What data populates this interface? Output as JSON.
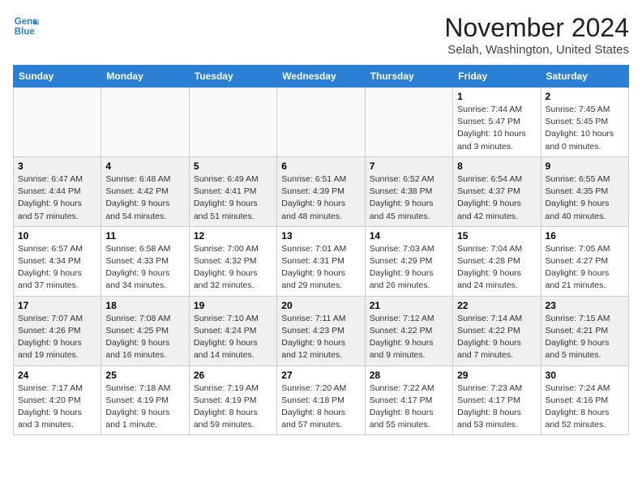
{
  "header": {
    "logo_line1": "General",
    "logo_line2": "Blue",
    "title": "November 2024",
    "subtitle": "Selah, Washington, United States"
  },
  "weekdays": [
    "Sunday",
    "Monday",
    "Tuesday",
    "Wednesday",
    "Thursday",
    "Friday",
    "Saturday"
  ],
  "weeks": [
    [
      {
        "day": "",
        "info": ""
      },
      {
        "day": "",
        "info": ""
      },
      {
        "day": "",
        "info": ""
      },
      {
        "day": "",
        "info": ""
      },
      {
        "day": "",
        "info": ""
      },
      {
        "day": "1",
        "info": "Sunrise: 7:44 AM\nSunset: 5:47 PM\nDaylight: 10 hours\nand 3 minutes."
      },
      {
        "day": "2",
        "info": "Sunrise: 7:45 AM\nSunset: 5:45 PM\nDaylight: 10 hours\nand 0 minutes."
      }
    ],
    [
      {
        "day": "3",
        "info": "Sunrise: 6:47 AM\nSunset: 4:44 PM\nDaylight: 9 hours\nand 57 minutes."
      },
      {
        "day": "4",
        "info": "Sunrise: 6:48 AM\nSunset: 4:42 PM\nDaylight: 9 hours\nand 54 minutes."
      },
      {
        "day": "5",
        "info": "Sunrise: 6:49 AM\nSunset: 4:41 PM\nDaylight: 9 hours\nand 51 minutes."
      },
      {
        "day": "6",
        "info": "Sunrise: 6:51 AM\nSunset: 4:39 PM\nDaylight: 9 hours\nand 48 minutes."
      },
      {
        "day": "7",
        "info": "Sunrise: 6:52 AM\nSunset: 4:38 PM\nDaylight: 9 hours\nand 45 minutes."
      },
      {
        "day": "8",
        "info": "Sunrise: 6:54 AM\nSunset: 4:37 PM\nDaylight: 9 hours\nand 42 minutes."
      },
      {
        "day": "9",
        "info": "Sunrise: 6:55 AM\nSunset: 4:35 PM\nDaylight: 9 hours\nand 40 minutes."
      }
    ],
    [
      {
        "day": "10",
        "info": "Sunrise: 6:57 AM\nSunset: 4:34 PM\nDaylight: 9 hours\nand 37 minutes."
      },
      {
        "day": "11",
        "info": "Sunrise: 6:58 AM\nSunset: 4:33 PM\nDaylight: 9 hours\nand 34 minutes."
      },
      {
        "day": "12",
        "info": "Sunrise: 7:00 AM\nSunset: 4:32 PM\nDaylight: 9 hours\nand 32 minutes."
      },
      {
        "day": "13",
        "info": "Sunrise: 7:01 AM\nSunset: 4:31 PM\nDaylight: 9 hours\nand 29 minutes."
      },
      {
        "day": "14",
        "info": "Sunrise: 7:03 AM\nSunset: 4:29 PM\nDaylight: 9 hours\nand 26 minutes."
      },
      {
        "day": "15",
        "info": "Sunrise: 7:04 AM\nSunset: 4:28 PM\nDaylight: 9 hours\nand 24 minutes."
      },
      {
        "day": "16",
        "info": "Sunrise: 7:05 AM\nSunset: 4:27 PM\nDaylight: 9 hours\nand 21 minutes."
      }
    ],
    [
      {
        "day": "17",
        "info": "Sunrise: 7:07 AM\nSunset: 4:26 PM\nDaylight: 9 hours\nand 19 minutes."
      },
      {
        "day": "18",
        "info": "Sunrise: 7:08 AM\nSunset: 4:25 PM\nDaylight: 9 hours\nand 16 minutes."
      },
      {
        "day": "19",
        "info": "Sunrise: 7:10 AM\nSunset: 4:24 PM\nDaylight: 9 hours\nand 14 minutes."
      },
      {
        "day": "20",
        "info": "Sunrise: 7:11 AM\nSunset: 4:23 PM\nDaylight: 9 hours\nand 12 minutes."
      },
      {
        "day": "21",
        "info": "Sunrise: 7:12 AM\nSunset: 4:22 PM\nDaylight: 9 hours\nand 9 minutes."
      },
      {
        "day": "22",
        "info": "Sunrise: 7:14 AM\nSunset: 4:22 PM\nDaylight: 9 hours\nand 7 minutes."
      },
      {
        "day": "23",
        "info": "Sunrise: 7:15 AM\nSunset: 4:21 PM\nDaylight: 9 hours\nand 5 minutes."
      }
    ],
    [
      {
        "day": "24",
        "info": "Sunrise: 7:17 AM\nSunset: 4:20 PM\nDaylight: 9 hours\nand 3 minutes."
      },
      {
        "day": "25",
        "info": "Sunrise: 7:18 AM\nSunset: 4:19 PM\nDaylight: 9 hours\nand 1 minute."
      },
      {
        "day": "26",
        "info": "Sunrise: 7:19 AM\nSunset: 4:19 PM\nDaylight: 8 hours\nand 59 minutes."
      },
      {
        "day": "27",
        "info": "Sunrise: 7:20 AM\nSunset: 4:18 PM\nDaylight: 8 hours\nand 57 minutes."
      },
      {
        "day": "28",
        "info": "Sunrise: 7:22 AM\nSunset: 4:17 PM\nDaylight: 8 hours\nand 55 minutes."
      },
      {
        "day": "29",
        "info": "Sunrise: 7:23 AM\nSunset: 4:17 PM\nDaylight: 8 hours\nand 53 minutes."
      },
      {
        "day": "30",
        "info": "Sunrise: 7:24 AM\nSunset: 4:16 PM\nDaylight: 8 hours\nand 52 minutes."
      }
    ]
  ]
}
